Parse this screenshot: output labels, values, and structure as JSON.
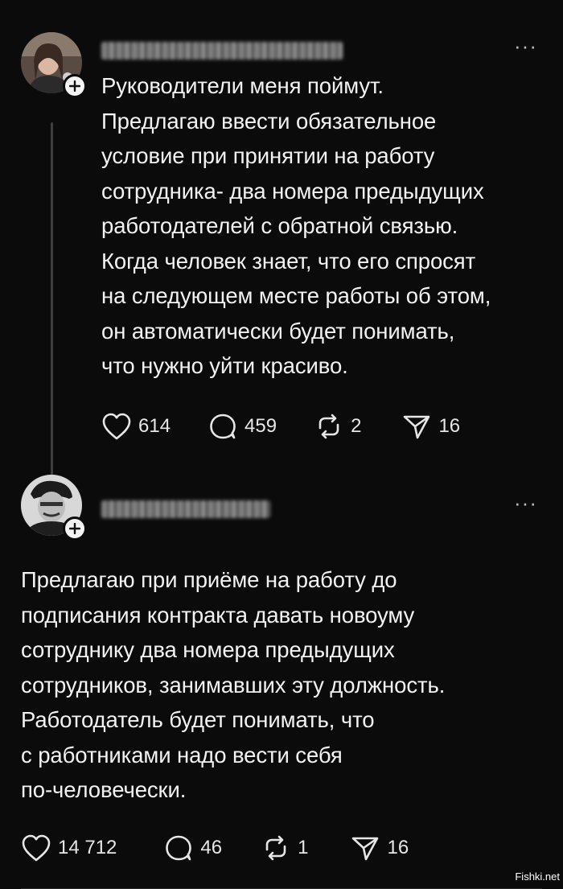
{
  "posts": [
    {
      "text": "Руководители меня поймут.\nПредлагаю ввести обязательное\nусловие при принятии на работу\nсотрудника- два номера предыдущих\nработодателей с обратной связью.\nКогда человек знает, что его спросят\nна следующем месте работы об этом,\nон автоматически будет понимать,\nчто нужно уйти красиво.",
      "likes": "614",
      "replies": "459",
      "reposts": "2",
      "shares": "16"
    },
    {
      "text": "Предлагаю при приёме на работу до\nподписания контракта давать новоуму\nсотруднику два номера предыдущих\nсотрудников, занимавших эту должность.\nРаботодатель будет понимать, что\nс работниками надо вести себя\nпо-человечески.",
      "likes": "14 712",
      "replies": "46",
      "reposts": "1",
      "shares": "16"
    }
  ],
  "more_label": "···",
  "watermark": "Fishki.net"
}
